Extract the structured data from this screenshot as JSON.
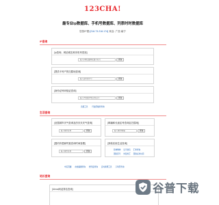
{
  "header": {
    "logo_text": "123CHA!",
    "headline": "最专业ip数据库、手机号数据库、列表时时数据库",
    "ip_prefix": "您的IP是:",
    "ip_value": "[216.73.216.174]",
    "ip_suffix": "来自: 广西 南宁"
  },
  "sections": [
    {
      "title": "IP查询",
      "cards": [
        {
          "title": "[ip查询、网站域名和手机号查找]",
          "placeholder": "输入ip地址或网址或手机号",
          "button": "查询"
        },
        {
          "title": "[提供卡号户的归属地查询]",
          "placeholder": "输入需查询卡号",
          "button": "查询"
        },
        {
          "title": "[身份证号码验证查询]",
          "placeholder": "输入15位或18位身份证号",
          "button": "查询"
        }
      ],
      "links": [
        "高级工具",
        "行政区编码查询"
      ]
    },
    {
      "title": "生活查询",
      "cards": [
        {
          "title": "[全国城市天气查询及历天天天气查询]",
          "placeholder": "输入城市名称",
          "button": "查询"
        },
        {
          "title": "[邮编和长途区号查询区归属地]",
          "placeholder": "输入城市/邮编",
          "button": "查询"
        },
        {
          "title": "[国内外国家时差查询时间查看]",
          "placeholder": "输入城市名称",
          "button": "查询"
        },
        {
          "title": "[其他实用生活查询]",
          "links": [
            "简体繁体",
            "汉字拼音",
            "汇率查询",
            "国际区号",
            "外贸外汇",
            "国际标准时间"
          ]
        }
      ],
      "links": [
        "中英互翻",
        "在线看图查询",
        "经纬度查询",
        "实时换算工具",
        "万年历查询"
      ]
    },
    {
      "title": "站长查询",
      "cards": [
        {
          "title": "[Alexa网站排名查询]"
        }
      ]
    }
  ],
  "watermark": {
    "text": "谷普下载",
    "icon": "shield-icon"
  },
  "colors": {
    "brand": "#e8282d",
    "link": "#1a5fb4",
    "watermark": "#68737e"
  }
}
